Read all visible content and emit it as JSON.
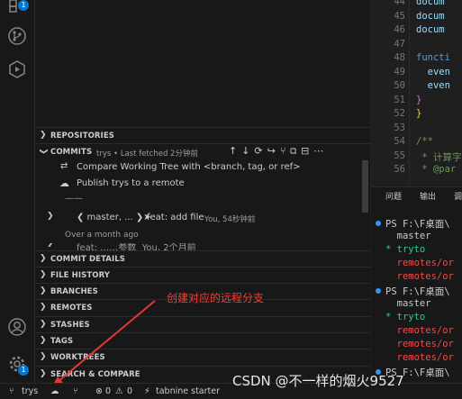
{
  "activity": {
    "source_control_badge": "1",
    "settings_badge": "1"
  },
  "sections": {
    "repositories": "REPOSITORIES",
    "commits": "COMMITS",
    "commit_details": "COMMIT DETAILS",
    "file_history": "FILE HISTORY",
    "branches": "BRANCHES",
    "remotes": "REMOTES",
    "stashes": "STASHES",
    "tags": "TAGS",
    "worktrees": "WORKTREES",
    "search_compare": "SEARCH & COMPARE"
  },
  "commits": {
    "subtitle": "trys • Last fetched 2分钟前",
    "compare_label": "Compare Working Tree with <branch, tag, or ref>",
    "publish_label": "Publish trys to a remote",
    "separator": "——",
    "commit_ref": "❮ master, ... ❯➤",
    "commit_message": "feat: add file",
    "commit_meta": "You, 54秒钟前",
    "group_label": "Over a month ago",
    "partial_row": "feat: ……参数  You, 2个月前"
  },
  "editor": {
    "lines": [
      {
        "num": "44",
        "text": "docum",
        "color": "#9cdcfe"
      },
      {
        "num": "45",
        "text": "docum",
        "color": "#9cdcfe"
      },
      {
        "num": "46",
        "text": "docum",
        "color": "#9cdcfe"
      },
      {
        "num": "47",
        "text": "",
        "color": "#cccccc"
      },
      {
        "num": "48",
        "text": "functi",
        "color": "#569cd6"
      },
      {
        "num": "49",
        "text": "  even",
        "color": "#9cdcfe"
      },
      {
        "num": "50",
        "text": "  even",
        "color": "#9cdcfe"
      },
      {
        "num": "51",
        "text": "}",
        "color": "#da70d6"
      },
      {
        "num": "52",
        "text": "}",
        "color": "#ffd700"
      },
      {
        "num": "53",
        "text": "",
        "color": "#cccccc"
      },
      {
        "num": "54",
        "text": "/**",
        "color": "#6a9955"
      },
      {
        "num": "55",
        "text": " * 计算字",
        "color": "#6a9955"
      },
      {
        "num": "56",
        "text": " * @par",
        "color": "#6a9955"
      }
    ]
  },
  "panel": {
    "tabs": [
      "问题",
      "输出",
      "调"
    ],
    "terminal": [
      {
        "text": "PS F:\\F桌面\\",
        "color": "#cccccc",
        "dot": true
      },
      {
        "text": "  master",
        "color": "#cccccc"
      },
      {
        "text": "* tryto",
        "color": "#23d18b"
      },
      {
        "text": "  remotes/or",
        "color": "#f14c4c"
      },
      {
        "text": "  remotes/or",
        "color": "#f14c4c"
      },
      {
        "text": "PS F:\\F桌面\\",
        "color": "#cccccc",
        "dot": true
      },
      {
        "text": "  master",
        "color": "#cccccc"
      },
      {
        "text": "* tryto",
        "color": "#23d18b"
      },
      {
        "text": "  remotes/or",
        "color": "#f14c4c"
      },
      {
        "text": "  remotes/or",
        "color": "#f14c4c"
      },
      {
        "text": "  remotes/or",
        "color": "#f14c4c"
      },
      {
        "text": "PS F:\\F桌面\\",
        "color": "#cccccc",
        "dot": true
      }
    ]
  },
  "status": {
    "branch": "trys",
    "errors": "0",
    "warnings": "0",
    "tabnine": "tabnine starter"
  },
  "annotation": {
    "text": "创建对应的远程分支",
    "color": "#ff3b30"
  },
  "watermark": "CSDN @不一样的烟火9527"
}
